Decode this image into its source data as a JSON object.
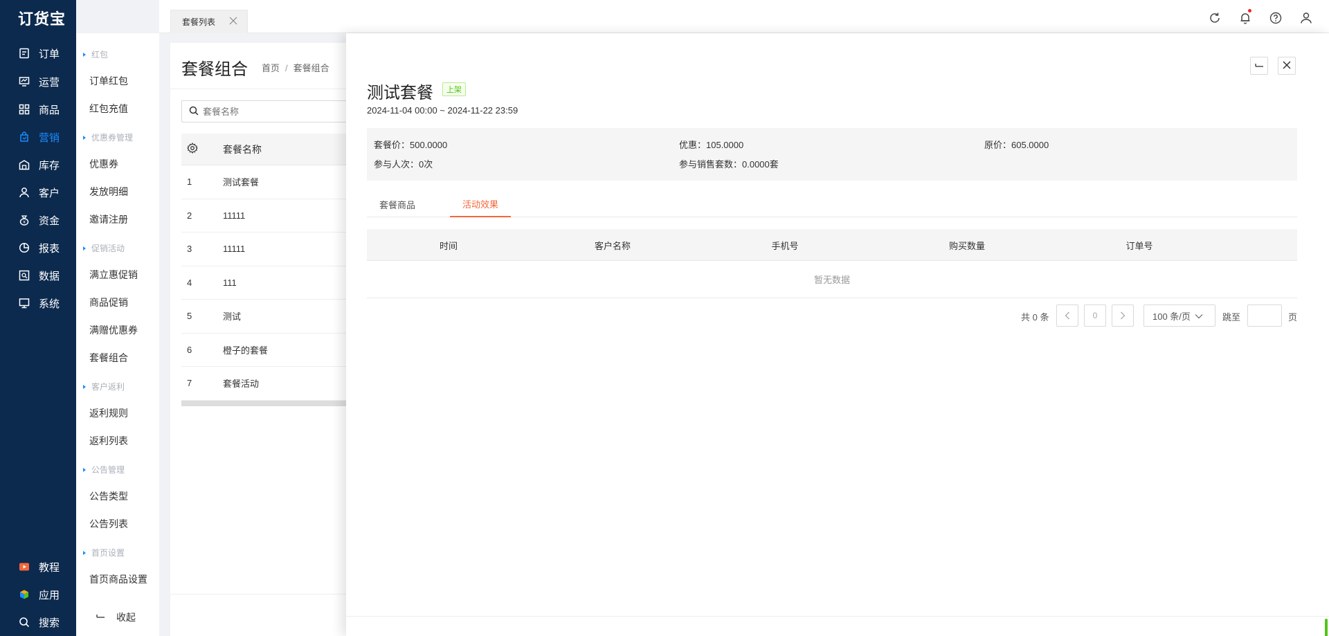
{
  "app": {
    "logo": "订货宝"
  },
  "nav": {
    "items": [
      {
        "label": "订单",
        "icon": "order-icon"
      },
      {
        "label": "运营",
        "icon": "operation-icon"
      },
      {
        "label": "商品",
        "icon": "goods-icon"
      },
      {
        "label": "营销",
        "icon": "marketing-icon",
        "active": true
      },
      {
        "label": "库存",
        "icon": "warehouse-icon"
      },
      {
        "label": "客户",
        "icon": "customer-icon"
      },
      {
        "label": "资金",
        "icon": "money-icon"
      },
      {
        "label": "报表",
        "icon": "report-icon"
      },
      {
        "label": "数据",
        "icon": "data-icon"
      },
      {
        "label": "系统",
        "icon": "system-icon"
      }
    ],
    "bottom": [
      {
        "label": "教程",
        "icon": "tutorial-icon"
      },
      {
        "label": "应用",
        "icon": "apps-icon"
      },
      {
        "label": "搜索",
        "icon": "search-icon"
      }
    ]
  },
  "submenu": {
    "groups": [
      "红包",
      "优惠券管理",
      "促销活动",
      "客户返利",
      "公告管理",
      "首页设置"
    ],
    "items": [
      "订单红包",
      "红包充值",
      "优惠券",
      "发放明细",
      "邀请注册",
      "满立惠促销",
      "商品促销",
      "满赠优惠券",
      "套餐组合",
      "返利规则",
      "返利列表",
      "公告类型",
      "公告列表",
      "首页商品设置"
    ],
    "collapse_label": "收起"
  },
  "topbar": {
    "tab_label": "套餐列表"
  },
  "list_page": {
    "title": "套餐组合",
    "breadcrumb": [
      "首页",
      "套餐组合"
    ],
    "search_placeholder": "套餐名称",
    "column_name": "套餐名称",
    "rows": [
      {
        "idx": "1",
        "name": "测试套餐"
      },
      {
        "idx": "2",
        "name": "11111"
      },
      {
        "idx": "3",
        "name": "11111"
      },
      {
        "idx": "4",
        "name": "111"
      },
      {
        "idx": "5",
        "name": "测试"
      },
      {
        "idx": "6",
        "name": "橙子的套餐"
      },
      {
        "idx": "7",
        "name": "套餐活动"
      }
    ]
  },
  "drawer": {
    "title": "测试套餐",
    "status_badge": "上架",
    "date_range": "2024-11-04 00:00 ~ 2024-11-22 23:59",
    "summary": {
      "package_price": "套餐价：500.0000",
      "discount": "优惠：105.0000",
      "original_price": "原价：605.0000",
      "participants": "参与人次：0次",
      "sold_sets": "参与销售套数：0.0000套"
    },
    "tabs": [
      "套餐商品",
      "活动效果"
    ],
    "active_tab": 1,
    "table": {
      "columns": [
        "时间",
        "客户名称",
        "手机号",
        "购买数量",
        "订单号"
      ],
      "empty_text": "暂无数据"
    },
    "pagination": {
      "total": "共 0 条",
      "current_page": "0",
      "page_size": "100 条/页",
      "jump_label": "跳至",
      "page_unit": "页"
    }
  },
  "colors": {
    "nav_bg": "#0c2a4e",
    "nav_active": "#1a8cff",
    "tab_active": "#f5673a",
    "badge_green": "#52c41a"
  }
}
